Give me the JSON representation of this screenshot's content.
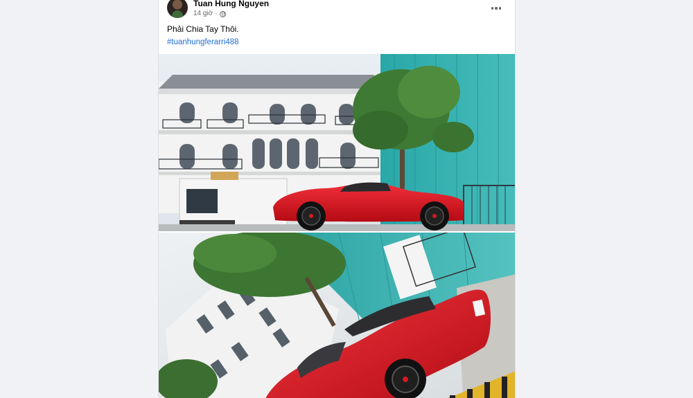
{
  "post": {
    "author": "Tuan Hung Nguyen",
    "time": "14 giờ",
    "privacy_icon": "globe-icon",
    "more_icon": "more-options-icon",
    "text": "Phải Chia Tay Thôi.",
    "hashtag": "#tuanhungferarri488",
    "photos": [
      "red-ferrari-photo-1",
      "red-ferrari-photo-2"
    ]
  },
  "colors": {
    "background": "#f0f2f5",
    "card": "#ffffff",
    "link": "#216fdb",
    "car_red": "#e3121b",
    "scaffold_teal": "#34b2b2"
  }
}
